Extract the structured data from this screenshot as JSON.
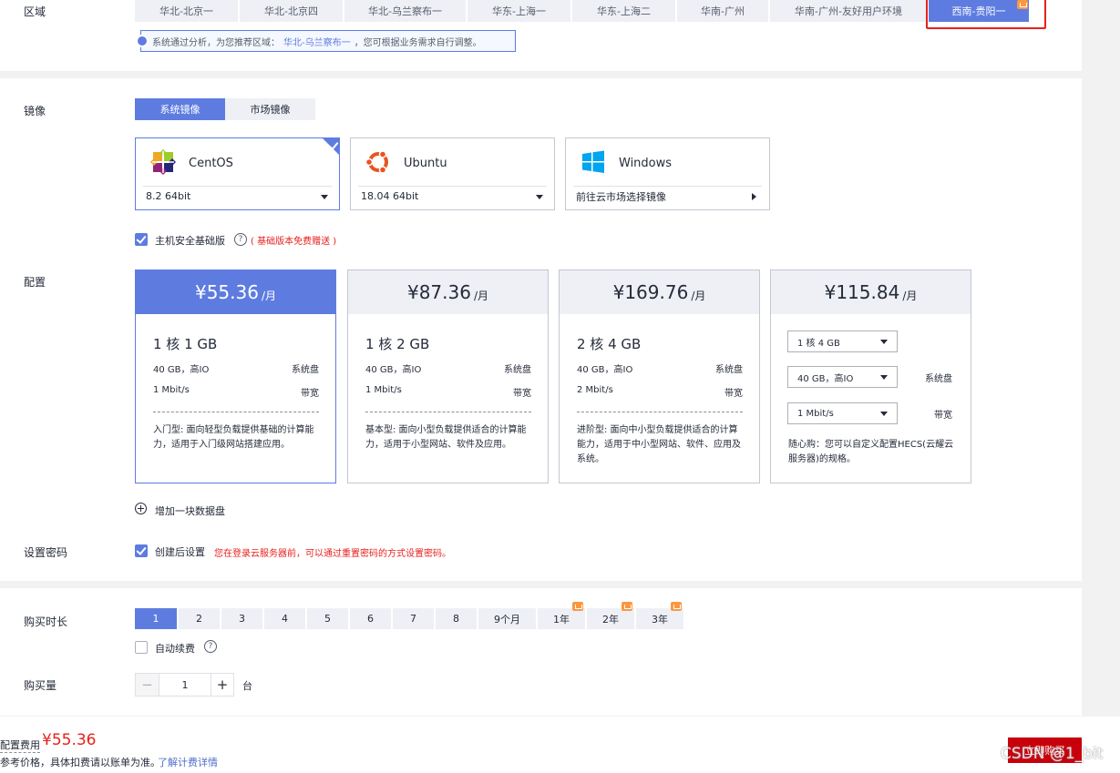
{
  "region": {
    "label": "区域",
    "tabs": [
      {
        "label": "华北-北京一",
        "w": 113
      },
      {
        "label": "华北-北京四",
        "w": 113
      },
      {
        "label": "华北-乌兰察布一",
        "w": 133
      },
      {
        "label": "华东-上海一",
        "w": 113
      },
      {
        "label": "华东-上海二",
        "w": 113
      },
      {
        "label": "华南-广州",
        "w": 100
      },
      {
        "label": "华南-广州-友好用户环境",
        "w": 172
      },
      {
        "label": "西南-贵阳一",
        "w": 110,
        "active": true
      }
    ],
    "tip_prefix": "系统通过分析，为您推荐区域：",
    "tip_region": "华北-乌兰察布一",
    "tip_suffix": "，您可根据业务需求自行调整。"
  },
  "image": {
    "label": "镜像",
    "tabs": [
      "系统镜像",
      "市场镜像"
    ],
    "os_cards": [
      {
        "name": "CentOS",
        "version": "8.2 64bit",
        "logo": "centos-logo"
      },
      {
        "name": "Ubuntu",
        "version": "18.04 64bit",
        "logo": "ubuntu-logo"
      },
      {
        "name": "Windows",
        "version": "前往云市场选择镜像",
        "logo": "windows-logo"
      }
    ],
    "security_label": "主机安全基础版",
    "security_note": "( 基础版本免费赠送 )"
  },
  "config": {
    "label": "配置",
    "cards": [
      {
        "price": "¥55.36",
        "unit": "/月",
        "spec": "1 核 1 GB",
        "disk": "40 GB，高IO",
        "disk_label": "系统盘",
        "bw": "1 Mbit/s",
        "bw_label": "带宽",
        "desc": "入门型: 面向轻型负载提供基础的计算能力，适用于入门级网站搭建应用。"
      },
      {
        "price": "¥87.36",
        "unit": "/月",
        "spec": "1 核 2 GB",
        "disk": "40 GB，高IO",
        "disk_label": "系统盘",
        "bw": "1 Mbit/s",
        "bw_label": "带宽",
        "desc": "基本型: 面向小型负载提供适合的计算能力，适用于小型网站、软件及应用。"
      },
      {
        "price": "¥169.76",
        "unit": "/月",
        "spec": "2 核 4 GB",
        "disk": "40 GB，高IO",
        "disk_label": "系统盘",
        "bw": "2 Mbit/s",
        "bw_label": "带宽",
        "desc": "进阶型: 面向中小型负载提供适合的计算能力，适用于中小型网站、软件、应用及系统。"
      },
      {
        "price": "¥115.84",
        "unit": "/月",
        "sel_spec": "1 核 4 GB",
        "sel_disk": "40 GB，高IO",
        "disk_label": "系统盘",
        "sel_bw": "1 Mbit/s",
        "bw_label": "带宽",
        "desc": "随心购：您可以自定义配置HECS(云耀云服务器)的规格。"
      }
    ],
    "add_disk": "增加一块数据盘"
  },
  "password": {
    "label": "设置密码",
    "option": "创建后设置",
    "note": "您在登录云服务器前，可以通过重置密码的方式设置密码。"
  },
  "duration": {
    "label": "购买时长",
    "options": [
      "1",
      "2",
      "3",
      "4",
      "5",
      "6",
      "7",
      "8",
      "9个月",
      "1年",
      "2年",
      "3年"
    ],
    "auto_renew": "自动续费"
  },
  "quantity": {
    "label": "购买量",
    "minus": "−",
    "value": "1",
    "plus": "+",
    "unit": "台"
  },
  "footer": {
    "fee_label": "配置费用",
    "fee_value": "¥55.36",
    "note": "参考价格，具体扣费请以账单为准。",
    "link": "了解计费详情",
    "buy": "立即购买",
    "watermark": "CSDN @1_bit"
  },
  "colors": {
    "accent": "#5e7ce0",
    "danger": "#e6211c",
    "buy": "#c7000b"
  }
}
